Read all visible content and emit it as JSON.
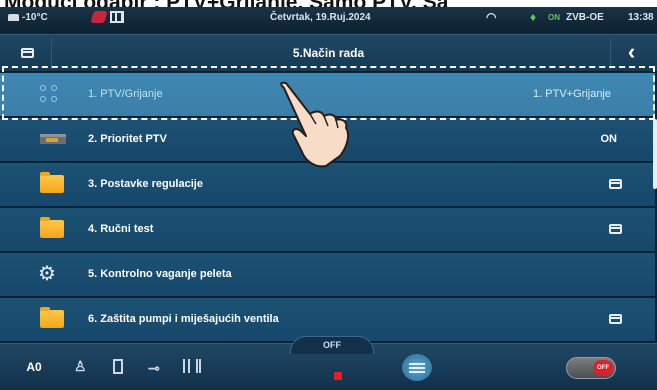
{
  "caption": "Mogući odabir : PTV+Grijanje, Samo PTV, Sa",
  "status_bar": {
    "temperature": "-10°C",
    "date": "Četvrtak, 19.Ruj.2024",
    "on_label": "ON",
    "device_code": "ZVB-OE",
    "time": "13:38",
    "icons": [
      "thermometer-icon",
      "alarm-icon",
      "grid-icon",
      "wifi-icon",
      "flame-icon"
    ]
  },
  "header": {
    "title": "5.Način rada",
    "back_symbol": "‹"
  },
  "menu": {
    "items": [
      {
        "label": "1. PTV/Grijanje",
        "value": "1. PTV+Grijanje",
        "icon": "dots-icon",
        "selected": true
      },
      {
        "label": "2. Prioritet PTV",
        "value": "ON",
        "icon": "device-icon"
      },
      {
        "label": "3. Postavke regulacije",
        "value": "",
        "icon": "folder-icon",
        "submenu": true
      },
      {
        "label": "4. Ručni test",
        "value": "",
        "icon": "folder-icon",
        "submenu": true
      },
      {
        "label": "5. Kontrolno vaganje peleta",
        "value": "",
        "icon": "gear-icon"
      },
      {
        "label": "6. Zaštita pumpi i miješajućih ventila",
        "value": "",
        "icon": "folder-icon",
        "submenu": true
      }
    ]
  },
  "bottom_bar": {
    "mode_label": "A0",
    "off_label": "OFF",
    "toggle_label": "OFF",
    "icons": [
      "mode-icon",
      "flame-icon",
      "tank-icon",
      "tap-icon",
      "radiator-icon",
      "menu-icon",
      "power-toggle-icon"
    ]
  },
  "colors": {
    "selected_row": "#3f88b2",
    "row": "#1c5274",
    "background": "#0e2436",
    "folder": "#f2a61a",
    "off_red": "#d9222d"
  }
}
